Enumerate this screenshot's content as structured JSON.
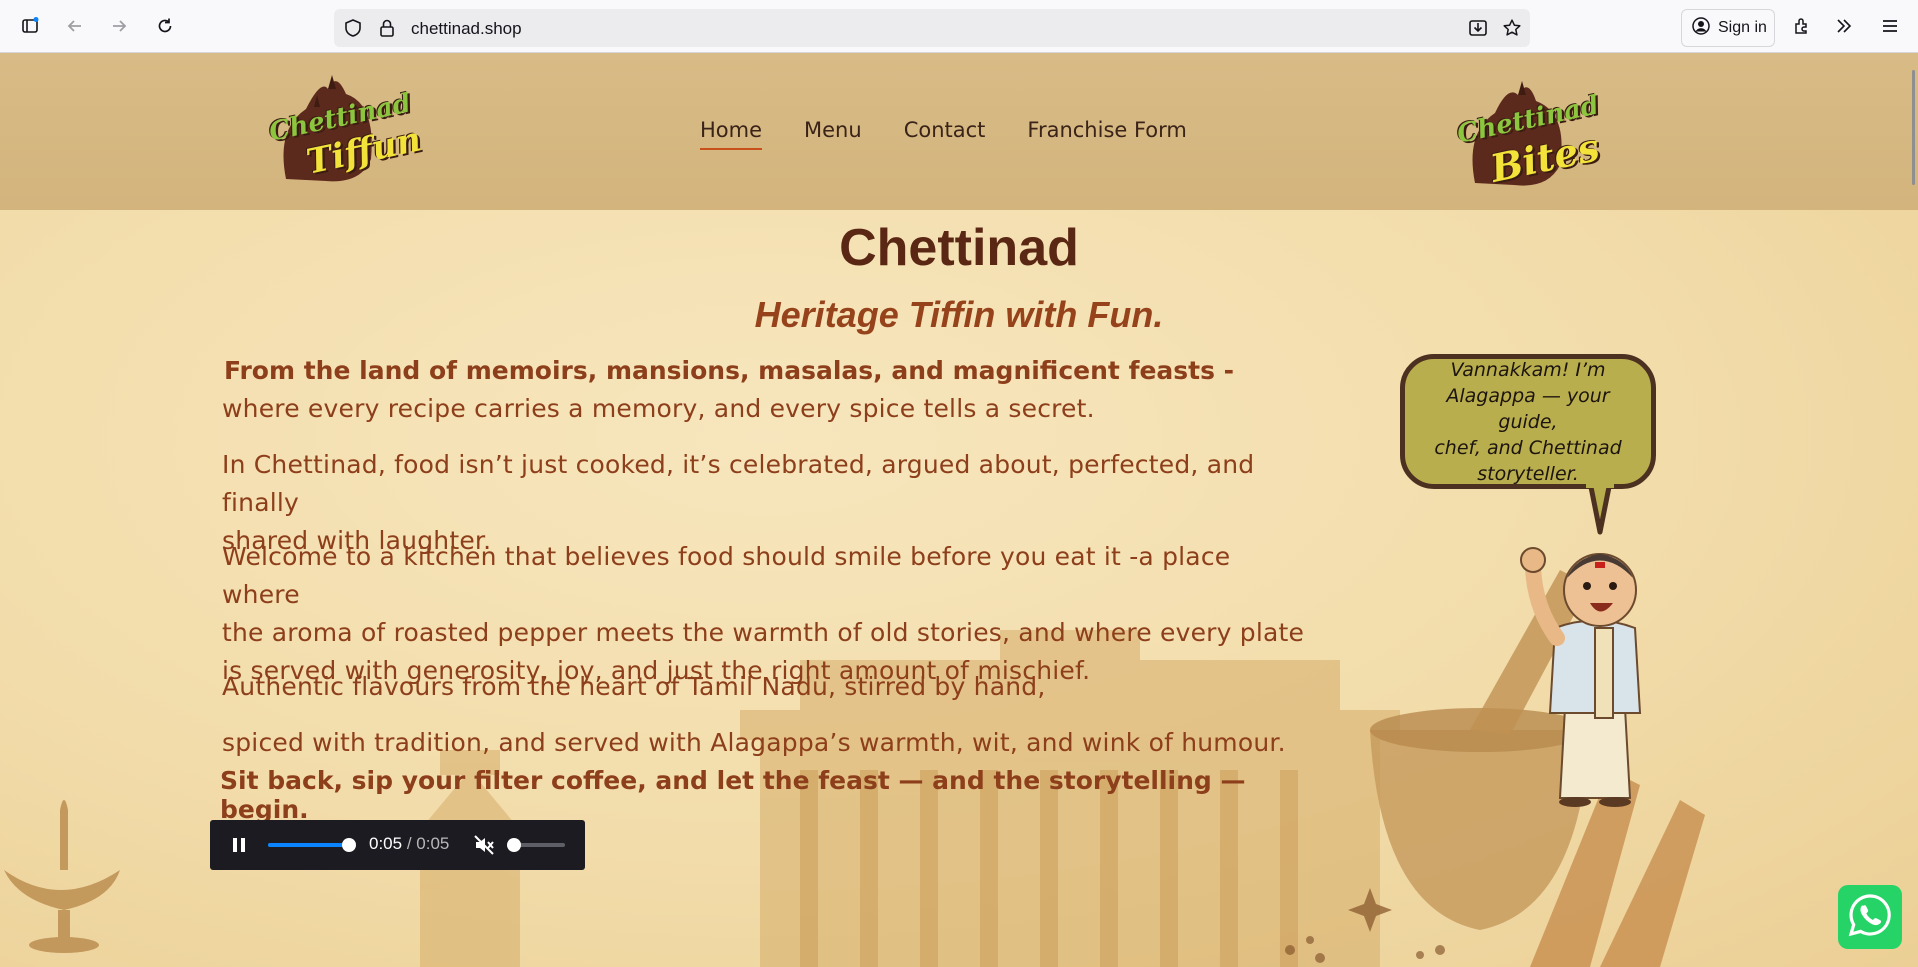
{
  "browser": {
    "url": "chettinad.shop",
    "signin_label": "Sign in"
  },
  "header": {
    "logo_left": {
      "line1": "Chettinad",
      "line2": "Tiffun"
    },
    "logo_right": {
      "line1": "Chettinad",
      "line2": "Bites"
    },
    "nav": [
      {
        "label": "Home",
        "active": true
      },
      {
        "label": "Menu",
        "active": false
      },
      {
        "label": "Contact",
        "active": false
      },
      {
        "label": "Franchise Form",
        "active": false
      }
    ]
  },
  "hero": {
    "title": "Chettinad",
    "tagline": "Heritage Tiffin with Fun.",
    "lead": "From the land of memoirs, mansions, masalas, and magnificent feasts -",
    "lead_sub": "where every recipe carries a memory, and every spice tells a secret.",
    "p1_line1": "In Chettinad, food isn’t just cooked, it’s celebrated, argued about, perfected, and finally",
    "p1_line2": "shared with laughter.",
    "p2_line1": "Welcome to a kitchen that believes food should smile before you eat it -a place where",
    "p2_line2": "the aroma of roasted pepper meets the warmth of old stories, and where every plate",
    "p2_line3": "is served with generosity, joy, and just the right amount of mischief.",
    "p3": "Authentic flavours from the heart of Tamil Nadu, stirred by hand,",
    "p4": "spiced with tradition, and served with Alagappa’s warmth, wit, and wink of humour.",
    "closing": "Sit back, sip your filter coffee, and let the feast — and the storytelling — begin."
  },
  "bubble": {
    "line1": "Vannakkam! I’m",
    "line2": "Alagappa — your guide,",
    "line3": "chef, and Chettinad",
    "line4": "storyteller."
  },
  "audio": {
    "current": "0:05",
    "separator": " / ",
    "duration": "0:05",
    "progress": 1.0,
    "volume": 0.0,
    "muted": true
  },
  "colors": {
    "accent": "#c8501a",
    "text_brown": "#8d3e1a",
    "title_brown": "#5a2714",
    "whatsapp": "#25d366"
  }
}
